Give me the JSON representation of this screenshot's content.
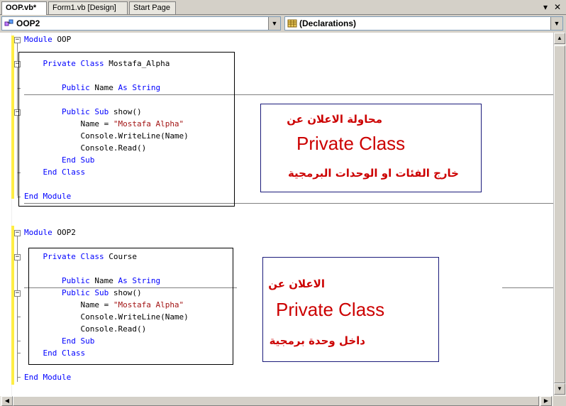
{
  "tabs": [
    {
      "label": "OOP.vb*",
      "active": true
    },
    {
      "label": "Form1.vb [Design]",
      "active": false
    },
    {
      "label": "Start Page",
      "active": false
    }
  ],
  "window_controls": {
    "menu": "▾",
    "close": "✕"
  },
  "dropdowns": {
    "left": {
      "value": "OOP2",
      "icon": "class-icon"
    },
    "right": {
      "value": "(Declarations)",
      "icon": "declarations-icon"
    }
  },
  "code": {
    "module1": {
      "header": [
        "Module",
        "OOP"
      ],
      "class_line": [
        "Private",
        "Class",
        "Mostafa_Alpha"
      ],
      "field_line": [
        "Public",
        "Name",
        "As",
        "String"
      ],
      "sub_line": [
        "Public",
        "Sub",
        "show()"
      ],
      "assign": {
        "left": "Name = ",
        "value": "\"Mostafa Alpha\""
      },
      "writeline": "Console.WriteLine(Name)",
      "read": "Console.Read()",
      "end_sub": [
        "End",
        "Sub"
      ],
      "end_class": [
        "End",
        "Class"
      ],
      "end_module": [
        "End",
        "Module"
      ]
    },
    "module2": {
      "header": [
        "Module",
        "OOP2"
      ],
      "class_line": [
        "Private",
        "Class",
        "Course"
      ],
      "field_line": [
        "Public",
        "Name",
        "As",
        "String"
      ],
      "sub_line": [
        "Public",
        "Sub",
        "show()"
      ],
      "assign": {
        "left": "Name = ",
        "value": "\"Mostafa Alpha\""
      },
      "writeline": "Console.WriteLine(Name)",
      "read": "Console.Read()",
      "end_sub": [
        "End",
        "Sub"
      ],
      "end_class": [
        "End",
        "Class"
      ],
      "end_module": [
        "End",
        "Module"
      ]
    }
  },
  "annotations": {
    "note1": {
      "line1": "محاولة الاعلان عن",
      "big": "Private Class",
      "line3": "خارج الفئات او الوحدات البرمجية"
    },
    "note2": {
      "line1": "الاعلان عن",
      "big": "Private Class",
      "line3": "داخل وحدة برمجية"
    }
  },
  "colors": {
    "keyword": "#0000ff",
    "string": "#a31515",
    "annotation": "#cc0000",
    "change_bar": "#ffee44"
  }
}
